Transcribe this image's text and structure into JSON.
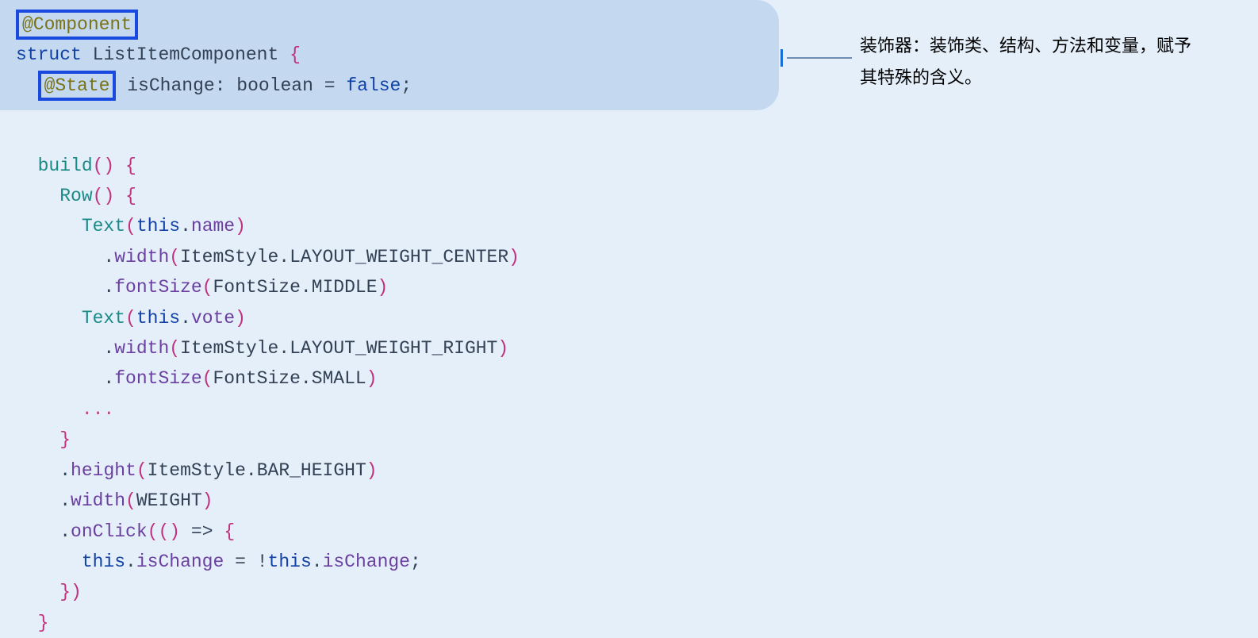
{
  "annotation": {
    "line1": "装饰器：装饰类、结构、方法和变量，赋予",
    "line2": "其特殊的含义。"
  },
  "code": {
    "decorator_component": "@Component",
    "struct_kw": "struct",
    "struct_name": "ListItemComponent",
    "brace_open": "{",
    "decorator_state": "@State",
    "state_var": "isChange",
    "state_type": "boolean",
    "state_init": "false",
    "build_fn": "build",
    "row_fn": "Row",
    "text_fn": "Text",
    "this_kw": "this",
    "prop_name": "name",
    "prop_vote": "vote",
    "width_fn": "width",
    "height_fn": "height",
    "fontsize_fn": "fontSize",
    "onclick_fn": "onClick",
    "itemstyle": "ItemStyle",
    "fontsize": "FontSize",
    "layout_center": "LAYOUT_WEIGHT_CENTER",
    "layout_right": "LAYOUT_WEIGHT_RIGHT",
    "font_middle": "MIDDLE",
    "font_small": "SMALL",
    "bar_height": "BAR_HEIGHT",
    "weight_const": "WEIGHT",
    "ellipsis": "...",
    "ischange": "isChange",
    "assign_expr_left": "isChange",
    "assign_expr_right": "isChange"
  }
}
